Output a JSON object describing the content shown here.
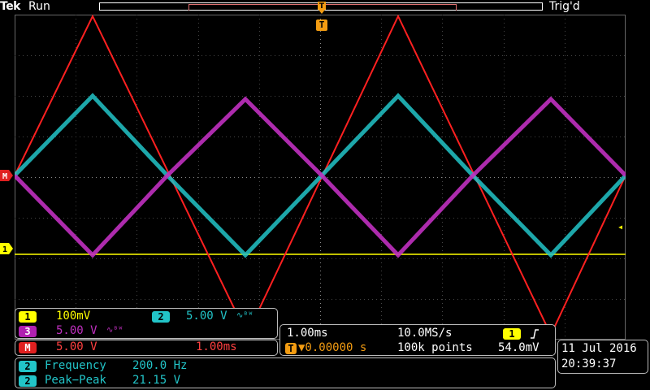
{
  "header": {
    "brand": "Tek",
    "run_state": "Run",
    "trigger_state": "Trig'd",
    "trigger_marker": "T"
  },
  "markers": {
    "math": "M",
    "ch1": "1"
  },
  "channels": {
    "ch1": {
      "badge": "1",
      "scale": "100mV",
      "color": "#ffff00"
    },
    "ch2": {
      "badge": "2",
      "scale": "5.00 V",
      "color": "#22c4c8"
    },
    "ch3": {
      "badge": "3",
      "scale": "5.00 V",
      "color": "#c030c0"
    },
    "math": {
      "badge": "M",
      "scale": "5.00 V",
      "time": "1.00ms",
      "color": "#ff2020"
    }
  },
  "timebase": {
    "horizontal_scale": "1.00ms",
    "sample_rate": "10.0MS/s",
    "trigger_source_badge": "1",
    "trigger_slope_icon": "rising-edge-icon",
    "trigger_position_badge": "T",
    "trigger_position": "▼0.00000 s",
    "record_length": "100k points",
    "trigger_level": "54.0mV"
  },
  "datetime": {
    "date": "11 Jul  2016",
    "time": "20:39:37"
  },
  "measurements": [
    {
      "badge": "2",
      "label": "Frequency",
      "value": "200.0 Hz"
    },
    {
      "badge": "2",
      "label": "Peak−Peak",
      "value": "21.15 V"
    }
  ],
  "bw_icon": "bandwidth-limit-icon"
}
